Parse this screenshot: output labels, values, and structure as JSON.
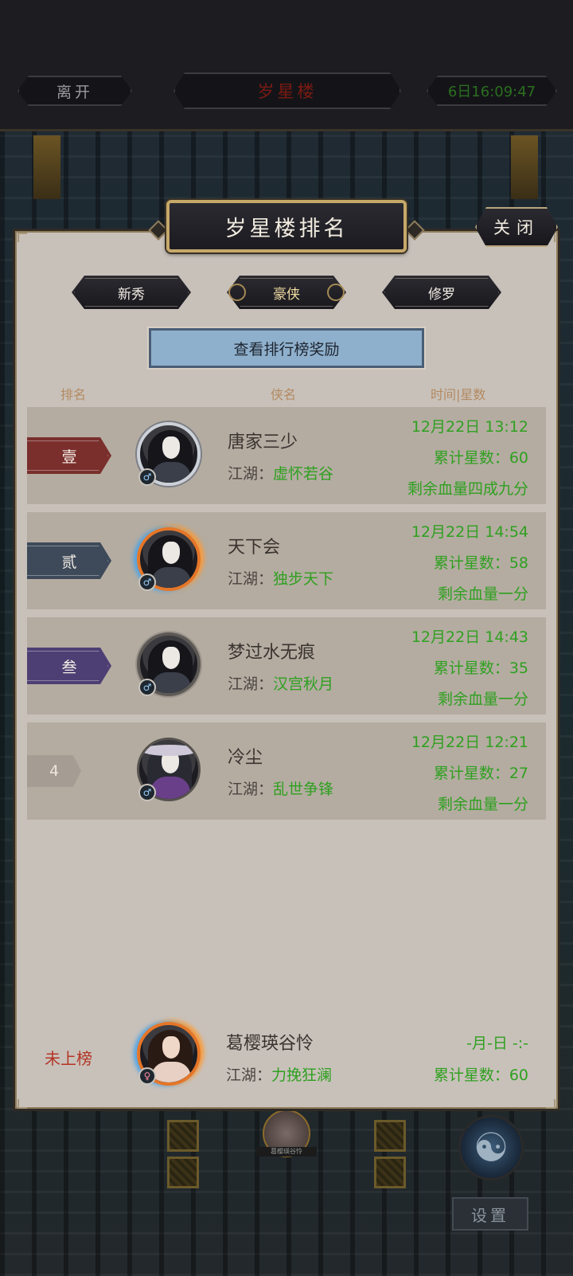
{
  "header": {
    "leave_label": "离开",
    "location_title": "岁星楼",
    "timer": "6日16:09:47"
  },
  "panel": {
    "title": "岁星楼排名",
    "close_label": "关闭",
    "tabs": [
      {
        "label": "新秀",
        "active": false
      },
      {
        "label": "豪侠",
        "active": true
      },
      {
        "label": "修罗",
        "active": false
      }
    ],
    "reward_button": "查看排行榜奖励",
    "columns": {
      "rank": "排名",
      "name": "侠名",
      "time_stars": "时间|星数"
    },
    "rows": [
      {
        "rank": "壹",
        "rank_color": "#7a2f2c",
        "name": "唐家三少",
        "jianghu_label": "江湖：",
        "jianghu": "虚怀若谷",
        "time": "12月22日 13:12",
        "stars": "累计星数：60",
        "hp": "剩余血量四成九分",
        "gender": "♂"
      },
      {
        "rank": "贰",
        "rank_color": "#3e4a5a",
        "name": "天下会",
        "jianghu_label": "江湖：",
        "jianghu": "独步天下",
        "time": "12月22日 14:54",
        "stars": "累计星数：58",
        "hp": "剩余血量一分",
        "gender": "♂"
      },
      {
        "rank": "叁",
        "rank_color": "#4d3f74",
        "name": "梦过水无痕",
        "jianghu_label": "江湖：",
        "jianghu": "汉宫秋月",
        "time": "12月22日 14:43",
        "stars": "累计星数：35",
        "hp": "剩余血量一分",
        "gender": "♂"
      },
      {
        "rank": "4",
        "rank_color": "#a59d93",
        "name": "冷尘",
        "jianghu_label": "江湖：",
        "jianghu": "乱世争锋",
        "time": "12月22日 12:21",
        "stars": "累计星数：27",
        "hp": "剩余血量一分",
        "gender": "♂"
      }
    ],
    "self": {
      "rank": "未上榜",
      "name": "葛樱瑛谷怜",
      "jianghu_label": "江湖：",
      "jianghu": "力挽狂澜",
      "time": "-月-日 -:-",
      "stars": "累计星数：60",
      "gender": "♀"
    }
  },
  "scene": {
    "player_name": "葛樱瑛谷怜",
    "settings_label": "设置",
    "taiji_icon": "yin-yang-icon"
  }
}
